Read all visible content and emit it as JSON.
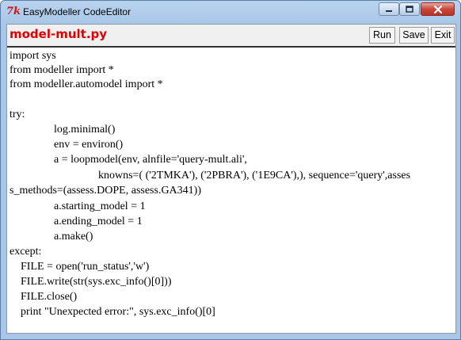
{
  "window": {
    "title": "EasyModeller CodeEditor",
    "app_icon_glyph": "7k",
    "close_glyph": "✕"
  },
  "editor": {
    "filename": "model-mult.py",
    "run_label": "Run",
    "save_label": "Save",
    "exit_label": "Exit",
    "lines": [
      "import sys",
      "from modeller import *",
      "from modeller.automodel import *",
      "",
      "try:",
      "                log.minimal()",
      "                env = environ()",
      "                a = loopmodel(env, alnfile='query-mult.ali',",
      "                                knowns=( ('2TMKA'), ('2PBRA'), ('1E9CA'),), sequence='query',asses",
      "s_methods=(assess.DOPE, assess.GA341))",
      "                a.starting_model = 1",
      "                a.ending_model = 1",
      "                a.make()",
      "except:",
      "    FILE = open('run_status','w')",
      "    FILE.write(str(sys.exc_info()[0]))",
      "    FILE.close()",
      "    print \"Unexpected error:\", sys.exc_info()[0]"
    ]
  },
  "colors": {
    "filename": "#e00000",
    "titlebar": "#a9c6e8",
    "close_button": "#c9463a"
  }
}
